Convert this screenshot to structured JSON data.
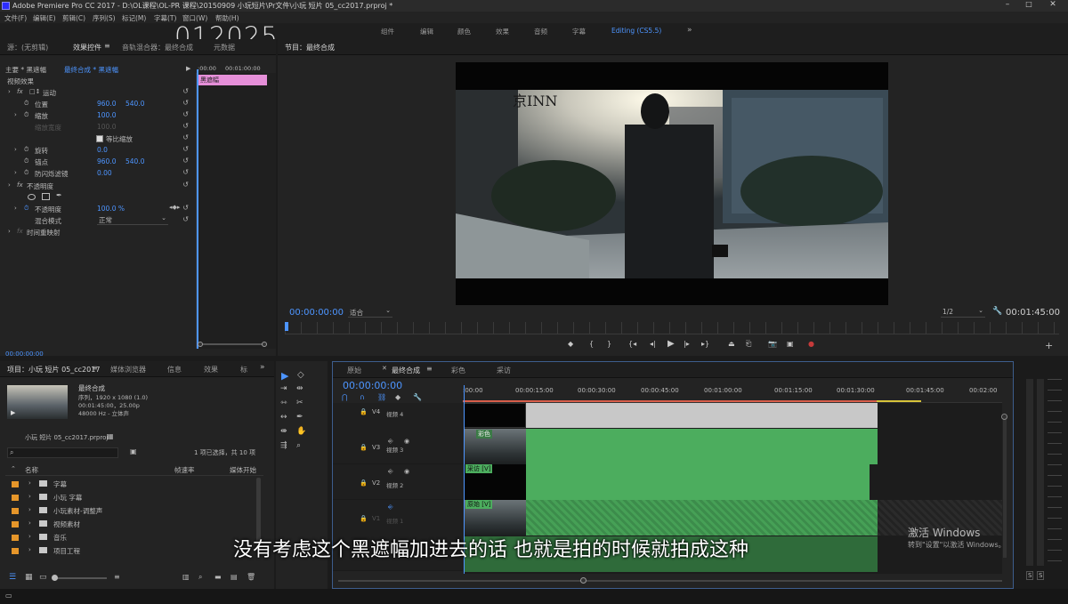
{
  "window": {
    "title": "Adobe Premiere Pro CC 2017 - D:\\OL课程\\OL-PR 课程\\20150909 小玩短片\\Pr文件\\小玩 短片 05_cc2017.prproj *"
  },
  "menu": [
    "文件(F)",
    "编辑(E)",
    "剪辑(C)",
    "序列(S)",
    "标记(M)",
    "字幕(T)",
    "窗口(W)",
    "帮助(H)"
  ],
  "workspaces": [
    "组件",
    "编辑",
    "颜色",
    "效果",
    "音频",
    "字幕",
    "Editing (CS5.5)"
  ],
  "watermark_code": "012025",
  "source_panel": {
    "tabs": [
      "源：(无剪辑)",
      "效果控件",
      "音轨混合器：最终合成",
      "元数据"
    ],
    "subheader": [
      "主要 * 黑遮幅",
      "最终合成 * 黑遮幅"
    ],
    "time_start": ":00:00",
    "time_end": "00:01:00:00",
    "clip_label": "黑遮幅",
    "section_video": "视频效果",
    "motion": "运动",
    "position_label": "位置",
    "position_x": "960.0",
    "position_y": "540.0",
    "scale_label": "缩放",
    "scale_value": "100.0",
    "scale_width_label": "缩放宽度",
    "scale_width_value": "100.0",
    "uniform_label": "等比缩放",
    "rotation_label": "旋转",
    "rotation_value": "0.0",
    "anchor_label": "锚点",
    "anchor_x": "960.0",
    "anchor_y": "540.0",
    "flicker_label": "防闪烁滤镜",
    "flicker_value": "0.00",
    "opacity_section": "不透明度",
    "opacity_label": "不透明度",
    "opacity_value": "100.0 %",
    "blend_label": "混合模式",
    "blend_value": "正常",
    "remap_label": "时间重映射",
    "bottom_time": "00:00:00:00"
  },
  "program_panel": {
    "title": "节目：最终合成",
    "scene_sign": "京INN",
    "current_time": "00:00:00:00",
    "fit": "适合",
    "resolution": "1/2",
    "duration": "00:01:45:00"
  },
  "project_panel": {
    "tabs": [
      "项目：小玩 短片 05_cc2017",
      "媒体浏览器",
      "信息",
      "效果",
      "标"
    ],
    "clip_name": "最终合成",
    "clip_type": "序列，1920 x 1080 (1.0)",
    "clip_duration": "00:01:45:00，25.00p",
    "clip_audio": "48000 Hz - 立体声",
    "project_file": "小玩 短片 05_cc2017.prproj",
    "selection_info": "1 项已选择，共 10 项",
    "col_name": "名称",
    "col_rate": "帧速率",
    "col_start": "媒体开始",
    "items": [
      "字幕",
      "小玩 字幕",
      "小玩素材-调整声",
      "视频素材",
      "音乐",
      "项目工程"
    ]
  },
  "timeline": {
    "tabs": [
      "原始",
      "最终合成",
      "彩色",
      "采访"
    ],
    "timecode": "00:00:00:00",
    "ruler": [
      ":00:00",
      "00:00:15:00",
      "00:00:30:00",
      "00:00:45:00",
      "00:01:00:00",
      "00:01:15:00",
      "00:01:30:00",
      "00:01:45:00",
      "00:02:00"
    ],
    "tracks": [
      {
        "id": "V4",
        "name": "视频 4"
      },
      {
        "id": "V3",
        "name": "视频 3"
      },
      {
        "id": "V2",
        "name": "视频 2"
      },
      {
        "id": "V1",
        "name": "视频 1"
      }
    ],
    "clip_v3": "彩色",
    "clip_v2": "采访 [V]",
    "clip_v1": "原始 [V]"
  },
  "subtitle": "没有考虑这个黑遮幅加进去的话 也就是拍的时候就拍成这种",
  "activation": {
    "line1": "激活 Windows",
    "line2": "转到\"设置\"以激活 Windows。"
  },
  "meter_labels": [
    "S",
    "S"
  ],
  "colors": {
    "accent_blue": "#4d95ff",
    "clip_green": "#4cad5e",
    "clip_pink": "#e58fd8",
    "folder_orange": "#e6962a"
  }
}
